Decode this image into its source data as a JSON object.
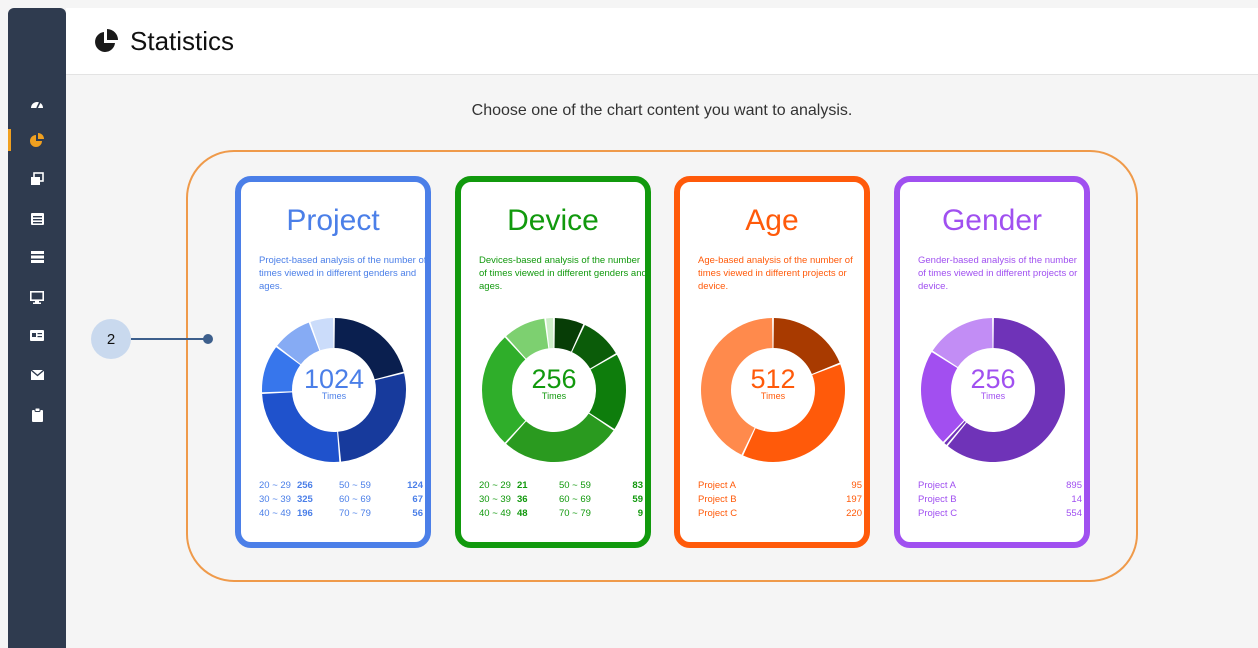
{
  "header": {
    "title": "Statistics"
  },
  "prompt": "Choose one of the chart content you want to analysis.",
  "callout": {
    "number": "2"
  },
  "sidebar": {
    "items": [
      {
        "icon": "dashboard-icon"
      },
      {
        "icon": "pie-chart-icon",
        "active": true
      },
      {
        "icon": "gallery-icon"
      },
      {
        "icon": "list-icon"
      },
      {
        "icon": "server-icon"
      },
      {
        "icon": "monitor-icon"
      },
      {
        "icon": "id-card-icon"
      },
      {
        "icon": "mail-icon"
      },
      {
        "icon": "clipboard-icon"
      }
    ]
  },
  "cards": [
    {
      "title": "Project",
      "description": "Project-based analysis of the number of times viewed in different genders and ages.",
      "total": "1024",
      "unit": "Times",
      "color": "#4b7fe8",
      "rows": [
        [
          "20 ~ 29",
          "256",
          "50 ~ 59",
          "124"
        ],
        [
          "30 ~ 39",
          "325",
          "60 ~ 69",
          "67"
        ],
        [
          "40 ~ 49",
          "196",
          "70 ~ 79",
          "56"
        ]
      ]
    },
    {
      "title": "Device",
      "description": "Devices-based analysis of the number of times viewed in different genders and ages.",
      "total": "256",
      "unit": "Times",
      "color": "#11990d",
      "rows": [
        [
          "20 ~ 29",
          "21",
          "50 ~ 59",
          "83"
        ],
        [
          "30 ~ 39",
          "36",
          "60 ~ 69",
          "59"
        ],
        [
          "40 ~ 49",
          "48",
          "70 ~ 79",
          "9"
        ]
      ]
    },
    {
      "title": "Age",
      "description": "Age-based analysis of the number of times viewed in different projects or device.",
      "total": "512",
      "unit": "Times",
      "color": "#ff5a0a",
      "rows": [
        [
          "Project A",
          "95"
        ],
        [
          "Project B",
          "197"
        ],
        [
          "Project C",
          "220"
        ]
      ]
    },
    {
      "title": "Gender",
      "description": "Gender-based analysis of the number of times viewed in different projects or device.",
      "total": "256",
      "unit": "Times",
      "color": "#a050f0",
      "rows": [
        [
          "Project A",
          "895"
        ],
        [
          "Project B",
          "14"
        ],
        [
          "Project C",
          "554"
        ]
      ]
    }
  ],
  "chart_data": [
    {
      "type": "pie",
      "series": [
        {
          "values": [
            23,
            30,
            28,
            12,
            10,
            6
          ]
        }
      ],
      "colors": [
        "#0a1f4f",
        "#173a9c",
        "#1f52cc",
        "#3776ec",
        "#86abf4",
        "#cbdcfa"
      ]
    },
    {
      "type": "pie",
      "series": [
        {
          "values": [
            7,
            10,
            18,
            28,
            27,
            10,
            2
          ]
        }
      ],
      "colors": [
        "#073d06",
        "#0b5c09",
        "#0e7d0c",
        "#2a9a1f",
        "#2fae2a",
        "#7dd070",
        "#cdeec8"
      ]
    },
    {
      "type": "pie",
      "series": [
        {
          "values": [
            19,
            38,
            43
          ]
        }
      ],
      "colors": [
        "#a83a00",
        "#ff5a0a",
        "#ff8a4c"
      ]
    },
    {
      "type": "pie",
      "series": [
        {
          "values": [
            61,
            1,
            22,
            16
          ]
        }
      ],
      "colors": [
        "#6f33b8",
        "#6f33b8",
        "#a24ff0",
        "#c28df5"
      ]
    }
  ]
}
